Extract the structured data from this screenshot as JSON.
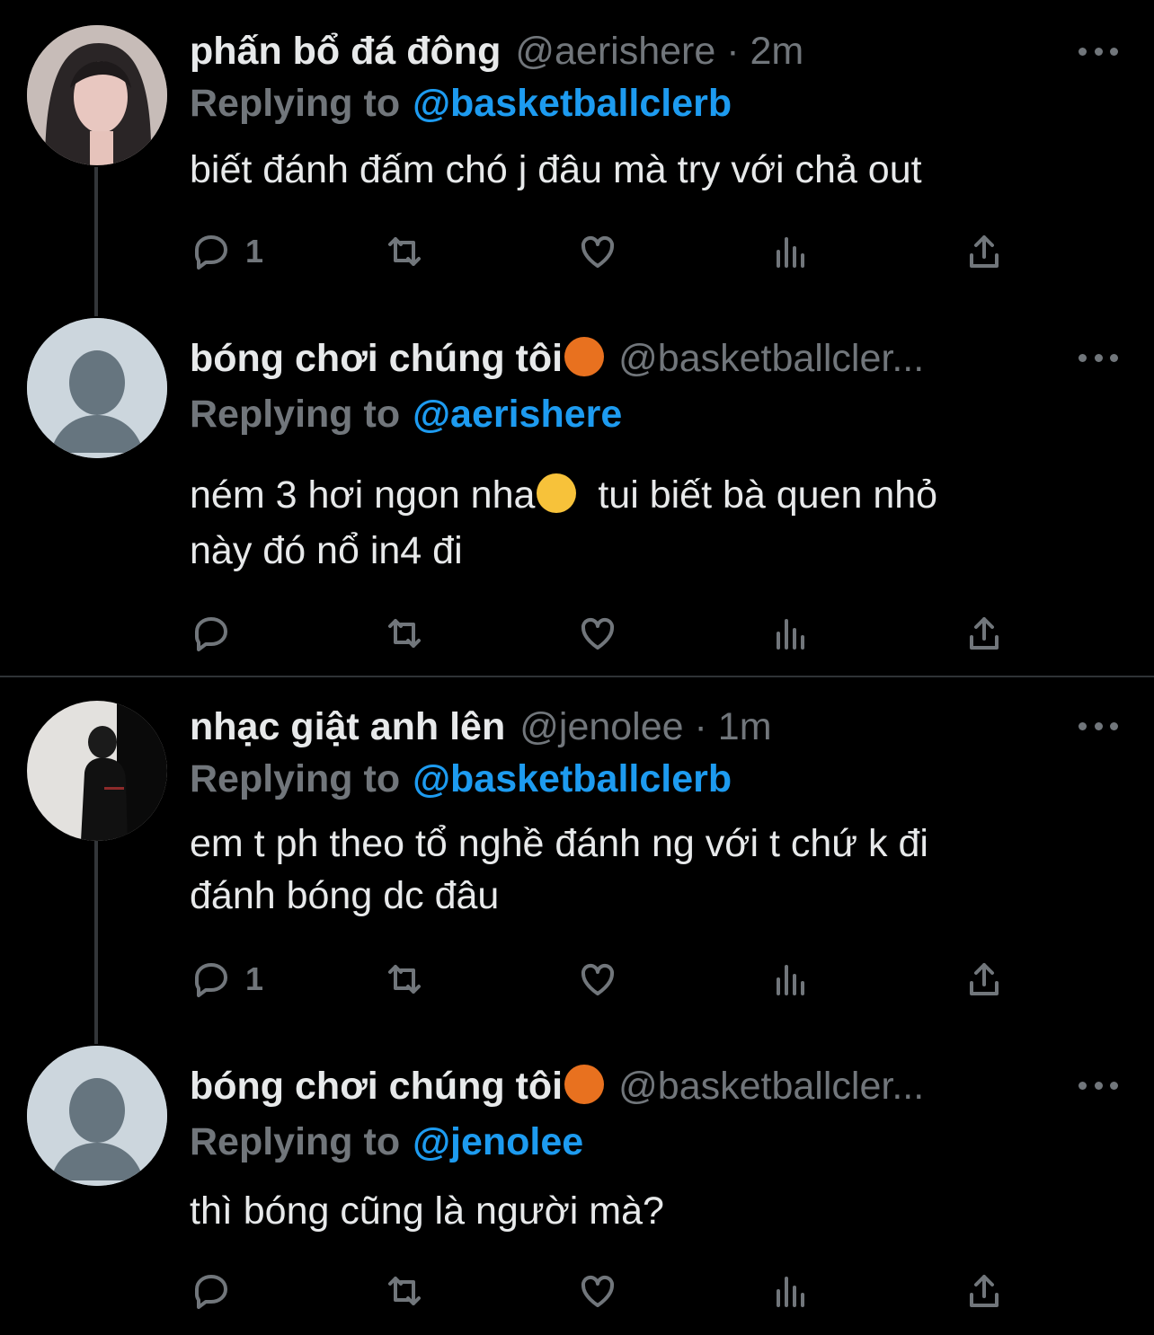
{
  "tweets": [
    {
      "name": "phấn bổ đá đông",
      "handle": "@aerishere · 2m",
      "replying_label": "Replying to",
      "replying_to": "@basketballclerb",
      "lines": [
        "biết đánh đấm chó j đâu mà try với chả out"
      ],
      "reply_count": "1"
    },
    {
      "name": "bóng chơi chúng tôi",
      "handle": "@basketballcler...",
      "replying_label": "Replying to",
      "replying_to": "@aerishere",
      "lines": [
        "ném 3 hơi ngon nha",
        "tui biết bà quen nhỏ",
        "này đó nổ in4 đi"
      ],
      "reply_count": ""
    },
    {
      "name": "nhạc giật anh lên",
      "handle": "@jenolee · 1m",
      "replying_label": "Replying to",
      "replying_to": "@basketballclerb",
      "lines": [
        "em t ph theo tổ nghề đánh ng với t chứ k đi",
        "đánh bóng dc đâu"
      ],
      "reply_count": "1"
    },
    {
      "name": "bóng chơi chúng tôi",
      "handle": "@basketballcler...",
      "replying_label": "Replying to",
      "replying_to": "@jenolee",
      "lines": [
        "thì bóng cũng là người mà?"
      ],
      "reply_count": ""
    }
  ],
  "icons": [
    "reply-icon",
    "retweet-icon",
    "like-icon",
    "analytics-icon",
    "share-icon",
    "more-icon",
    "basketball-emoji",
    "smirk-emoji"
  ],
  "colors": {
    "background": "#000000",
    "text": "#e7e9ea",
    "secondary": "#71767b",
    "accent": "#1d9bf0",
    "divider": "#2f3336"
  }
}
